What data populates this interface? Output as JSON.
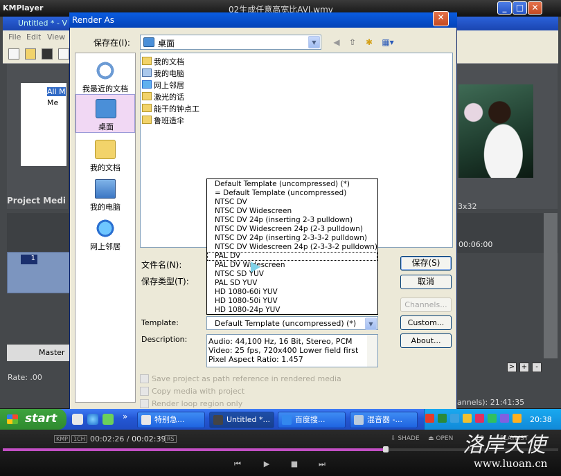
{
  "kmplayer": {
    "logo": "KMPlayer",
    "file_title": "02生成任意高宽比AVI.wmv",
    "min": "_",
    "restore": "□",
    "close": "✕",
    "time_current": "00:02:26",
    "time_total": "00:02:39",
    "badge_kmp": "KMP",
    "badge_1ch": "1CH",
    "badge_rs": "RS",
    "menu_shade": "SHADE",
    "menu_open": "OPEN",
    "menu_ls": "LS",
    "menu_playlist": "PLAYLIST",
    "progress": 0.685,
    "btn_prev": "⏮",
    "btn_play": "▶",
    "btn_stop": "■",
    "btn_next": "⏭"
  },
  "vegas": {
    "title": "Untitled * - V",
    "menu": [
      "File",
      "Edit",
      "View"
    ],
    "tree_items": [
      "All M",
      "Me"
    ],
    "project_media_tab": "Project Medi",
    "preview_res": "3x32",
    "timecode": "00:06:00",
    "track_num": "1",
    "master_label": "Master",
    "rate_label": "Rate: .00",
    "channels_status": "annels): 21:41:35",
    "nav": [
      ">",
      "+",
      "-"
    ]
  },
  "dialog": {
    "title": "Render As",
    "close": "✕",
    "save_in_label": "保存在(I):",
    "save_in_value": "桌面",
    "places": [
      "我最近的文档",
      "桌面",
      "我的文档",
      "我的电脑",
      "网上邻居"
    ],
    "files": [
      "我的文档",
      "我的电脑",
      "网上邻居",
      "激光的话",
      "能干的钟点工",
      "鲁班造伞"
    ],
    "file_name_label": "文件名(N):",
    "file_type_label": "保存类型(T):",
    "save_btn": "保存(S)",
    "cancel_btn": "取消",
    "channels_btn": "Channels...",
    "custom_btn": "Custom...",
    "about_btn": "About...",
    "template_label": "Template:",
    "template_value": "Default Template (uncompressed) (*)",
    "template_options": [
      "Default Template (uncompressed) (*)",
      "= Default Template (uncompressed)",
      "NTSC DV",
      "NTSC DV Widescreen",
      "NTSC DV 24p (inserting 2-3 pulldown)",
      "NTSC DV Widescreen 24p (2-3 pulldown)",
      "NTSC DV 24p (inserting 2-3-3-2 pulldown)",
      "NTSC DV Widescreen 24p (2-3-3-2 pulldown)",
      "PAL DV",
      "PAL DV Widescreen",
      "NTSC SD YUV",
      "PAL SD YUV",
      "HD 1080-60i YUV",
      "HD 1080-50i YUV",
      "HD 1080-24p YUV"
    ],
    "highlighted_index": 8,
    "description_label": "Description:",
    "description_lines": [
      "Audio: 44,100 Hz, 16 Bit, Stereo, PCM",
      "Video: 25 fps, 720x400 Lower field first",
      "Pixel Aspect Ratio: 1.457"
    ],
    "options": [
      "Save project as path reference in rendered media",
      "Copy media with project",
      "Render loop region only"
    ]
  },
  "taskbar": {
    "start": "start",
    "tasks": [
      "特别急...",
      "Untitled *...",
      "百度搜...",
      "混音器 -..."
    ],
    "active_index": 1,
    "clock": "20:38",
    "chevron": "»"
  },
  "watermark": {
    "cn": "洛岸天使",
    "url": "www.luoan.cn"
  },
  "colors": {
    "xp_title_blue": "#0a5ce0",
    "taskbar_blue": "#2457d4",
    "start_green": "#3ea33e",
    "dialog_bg": "#ece9d8",
    "seek_purple": "#c34fc5"
  }
}
